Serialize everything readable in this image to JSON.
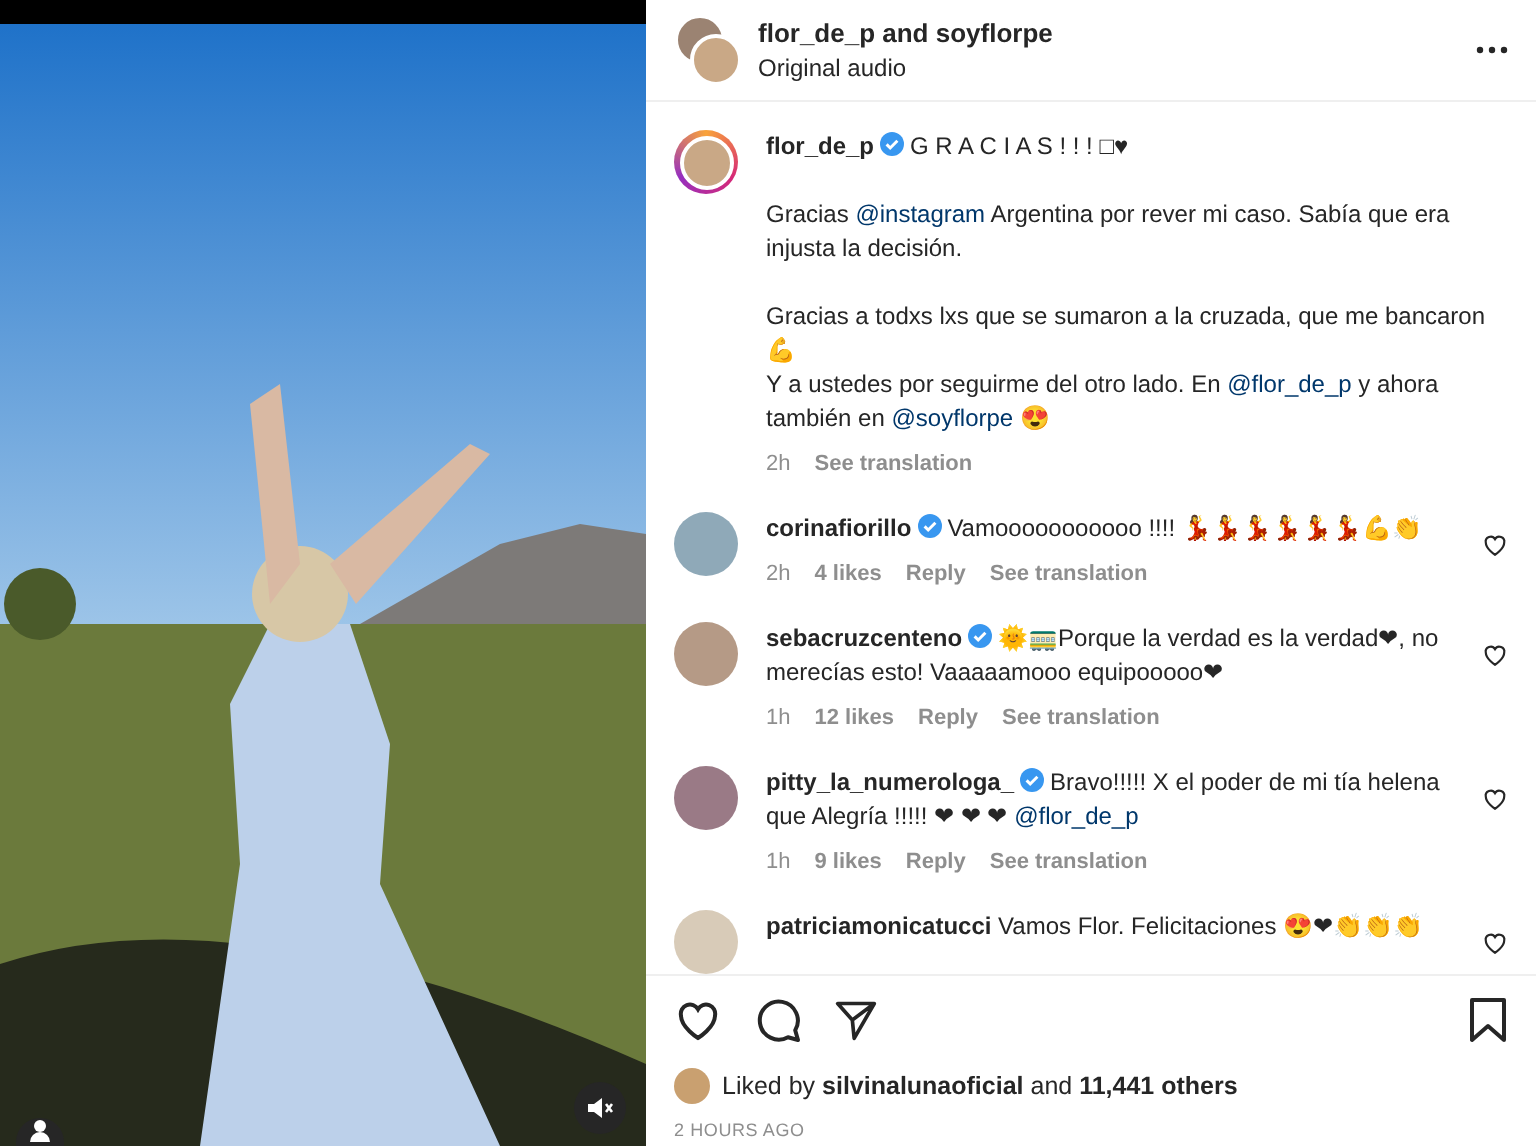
{
  "video": {
    "muted": true
  },
  "header": {
    "accounts": "flor_de_p and soyflorpe",
    "audio": "Original audio"
  },
  "caption": {
    "username": "flor_de_p",
    "verified": true,
    "segments": [
      {
        "kind": "text",
        "text": "G R A C I A S ! ! ! □♥"
      },
      {
        "kind": "break"
      },
      {
        "kind": "text",
        "text": "Gracias "
      },
      {
        "kind": "mention",
        "text": "@instagram"
      },
      {
        "kind": "text",
        "text": " Argentina por rever mi caso. Sabía que era injusta la decisión."
      },
      {
        "kind": "break"
      },
      {
        "kind": "text",
        "text": "Gracias a todxs lxs que se sumaron a la cruzada, que me bancaron 💪"
      },
      {
        "kind": "line"
      },
      {
        "kind": "text",
        "text": "Y a ustedes por seguirme del otro lado. En "
      },
      {
        "kind": "mention",
        "text": "@flor_de_p"
      },
      {
        "kind": "text",
        "text": " y ahora también en "
      },
      {
        "kind": "mention",
        "text": "@soyflorpe"
      },
      {
        "kind": "text",
        "text": " 😍"
      }
    ],
    "time": "2h",
    "translate": "See translation"
  },
  "comments": [
    {
      "username": "corinafiorillo",
      "verified": true,
      "color": "#8fa9b8",
      "segments": [
        {
          "kind": "text",
          "text": "Vamooooooooooo !!!! 💃💃💃💃💃💃💪👏"
        }
      ],
      "time": "2h",
      "likes": "4 likes",
      "reply": "Reply",
      "translate": "See translation",
      "liked": false
    },
    {
      "username": "sebacruzcenteno",
      "verified": true,
      "color": "#b59a86",
      "segments": [
        {
          "kind": "text",
          "text": "🌞🚃Porque la verdad es la verdad❤, no merecías esto! Vaaaaamooo equipooooo❤"
        }
      ],
      "time": "1h",
      "likes": "12 likes",
      "reply": "Reply",
      "translate": "See translation",
      "liked": false
    },
    {
      "username": "pitty_la_numerologa_",
      "verified": true,
      "color": "#9a7a86",
      "segments": [
        {
          "kind": "text",
          "text": "Bravo!!!!! X el poder de mi tía helena que Alegría !!!!! ❤ ❤ ❤ "
        },
        {
          "kind": "mention",
          "text": "@flor_de_p"
        }
      ],
      "time": "1h",
      "likes": "9 likes",
      "reply": "Reply",
      "translate": "See translation",
      "liked": false
    },
    {
      "username": "patriciamonicatucci",
      "verified": false,
      "color": "#d8cbb8",
      "segments": [
        {
          "kind": "text",
          "text": "Vamos Flor. Felicitaciones 😍❤👏👏👏"
        }
      ],
      "liked": false
    }
  ],
  "actions": {
    "liked": false,
    "saved": false
  },
  "likes": {
    "prefix": "Liked by ",
    "user": "silvinalunaoficial",
    "middle": " and ",
    "count": "11,441 others"
  },
  "posted": "2 HOURS AGO"
}
